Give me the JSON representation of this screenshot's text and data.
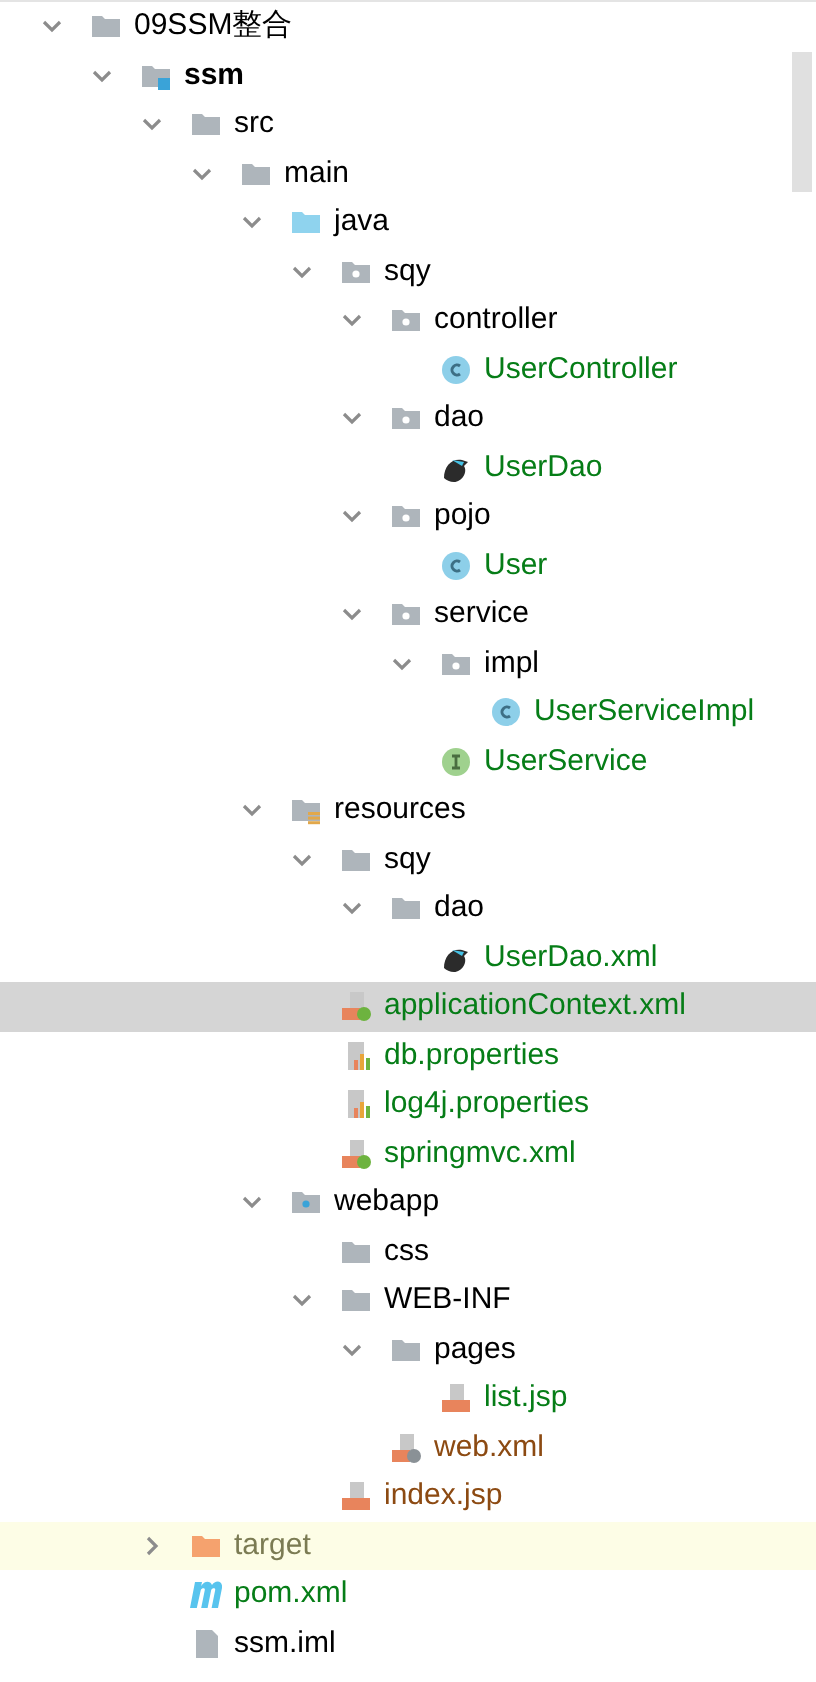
{
  "tree": [
    {
      "label": "09SSM整合",
      "kind": "folder",
      "expanded": true,
      "selected": false,
      "children": [
        {
          "label": "ssm",
          "kind": "module",
          "bold": true,
          "expanded": true,
          "selected": false,
          "children": [
            {
              "label": "src",
              "kind": "folder",
              "expanded": true,
              "selected": false,
              "children": [
                {
                  "label": "main",
                  "kind": "folder",
                  "expanded": true,
                  "selected": false,
                  "children": [
                    {
                      "label": "java",
                      "kind": "source-folder",
                      "expanded": true,
                      "selected": false,
                      "children": [
                        {
                          "label": "sqy",
                          "kind": "package",
                          "expanded": true,
                          "selected": false,
                          "children": [
                            {
                              "label": "controller",
                              "kind": "package",
                              "expanded": true,
                              "selected": false,
                              "children": [
                                {
                                  "label": "UserController",
                                  "kind": "class",
                                  "color": "#067d17",
                                  "selected": false
                                }
                              ]
                            },
                            {
                              "label": "dao",
                              "kind": "package",
                              "expanded": true,
                              "selected": false,
                              "children": [
                                {
                                  "label": "UserDao",
                                  "kind": "mapper",
                                  "color": "#067d17",
                                  "selected": false
                                }
                              ]
                            },
                            {
                              "label": "pojo",
                              "kind": "package",
                              "expanded": true,
                              "selected": false,
                              "children": [
                                {
                                  "label": "User",
                                  "kind": "class",
                                  "color": "#067d17",
                                  "selected": false
                                }
                              ]
                            },
                            {
                              "label": "service",
                              "kind": "package",
                              "expanded": true,
                              "selected": false,
                              "children": [
                                {
                                  "label": "impl",
                                  "kind": "package",
                                  "expanded": true,
                                  "selected": false,
                                  "children": [
                                    {
                                      "label": "UserServiceImpl",
                                      "kind": "class",
                                      "color": "#067d17",
                                      "selected": false
                                    }
                                  ]
                                },
                                {
                                  "label": "UserService",
                                  "kind": "interface",
                                  "color": "#067d17",
                                  "selected": false
                                }
                              ]
                            }
                          ]
                        }
                      ]
                    },
                    {
                      "label": "resources",
                      "kind": "resources",
                      "expanded": true,
                      "selected": false,
                      "children": [
                        {
                          "label": "sqy",
                          "kind": "folder",
                          "expanded": true,
                          "selected": false,
                          "children": [
                            {
                              "label": "dao",
                              "kind": "folder",
                              "expanded": true,
                              "selected": false,
                              "children": [
                                {
                                  "label": "UserDao.xml",
                                  "kind": "mapper",
                                  "color": "#067d17",
                                  "selected": false
                                }
                              ]
                            }
                          ]
                        },
                        {
                          "label": "applicationContext.xml",
                          "kind": "spring-xml",
                          "color": "#067d17",
                          "selected": true
                        },
                        {
                          "label": "db.properties",
                          "kind": "properties",
                          "color": "#067d17",
                          "selected": false
                        },
                        {
                          "label": "log4j.properties",
                          "kind": "properties",
                          "color": "#067d17",
                          "selected": false
                        },
                        {
                          "label": "springmvc.xml",
                          "kind": "spring-xml",
                          "color": "#067d17",
                          "selected": false
                        }
                      ]
                    },
                    {
                      "label": "webapp",
                      "kind": "web-folder",
                      "expanded": true,
                      "selected": false,
                      "children": [
                        {
                          "label": "css",
                          "kind": "folder",
                          "selected": false
                        },
                        {
                          "label": "WEB-INF",
                          "kind": "folder",
                          "expanded": true,
                          "selected": false,
                          "children": [
                            {
                              "label": "pages",
                              "kind": "folder",
                              "expanded": true,
                              "selected": false,
                              "children": [
                                {
                                  "label": "list.jsp",
                                  "kind": "jsp",
                                  "color": "#067d17",
                                  "selected": false
                                }
                              ]
                            },
                            {
                              "label": "web.xml",
                              "kind": "web-xml",
                              "color": "#8c4a12",
                              "selected": false
                            }
                          ]
                        },
                        {
                          "label": "index.jsp",
                          "kind": "jsp",
                          "color": "#8c4a12",
                          "selected": false
                        }
                      ]
                    }
                  ]
                }
              ]
            },
            {
              "label": "target",
              "kind": "excluded-folder",
              "color": "#7b7b53",
              "expanded": false,
              "selected": false
            },
            {
              "label": "pom.xml",
              "kind": "maven",
              "color": "#067d17",
              "selected": false
            },
            {
              "label": "ssm.iml",
              "kind": "file",
              "selected": false
            }
          ]
        }
      ]
    }
  ]
}
